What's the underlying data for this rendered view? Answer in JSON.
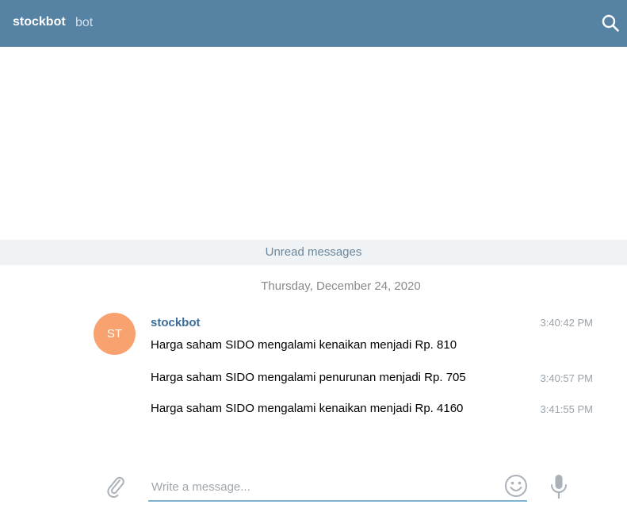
{
  "header": {
    "title": "stockbot",
    "subtitle": "bot",
    "search_icon": "search-icon"
  },
  "chat": {
    "unread_label": "Unread messages",
    "date_separator": "Thursday, December 24, 2020",
    "sender": {
      "name": "stockbot",
      "initials": "ST",
      "avatar_color": "#f7a26f"
    },
    "messages": [
      {
        "text": "Harga saham SIDO mengalami kenaikan menjadi Rp. 810",
        "time": "3:40:42 PM"
      },
      {
        "text": "Harga saham SIDO mengalami penurunan menjadi Rp. 705",
        "time": "3:40:57 PM"
      },
      {
        "text": "Harga saham SIDO mengalami kenaikan menjadi Rp. 4160",
        "time": "3:41:55 PM"
      }
    ]
  },
  "composer": {
    "placeholder": "Write a message...",
    "value": "",
    "icons": [
      "paperclip-icon",
      "emoji-icon",
      "microphone-icon"
    ]
  },
  "colors": {
    "header_bg": "#5682a3",
    "unread_bg": "#eff3f6",
    "sender_name": "#3a6d99",
    "input_underline": "#7db3cf"
  }
}
